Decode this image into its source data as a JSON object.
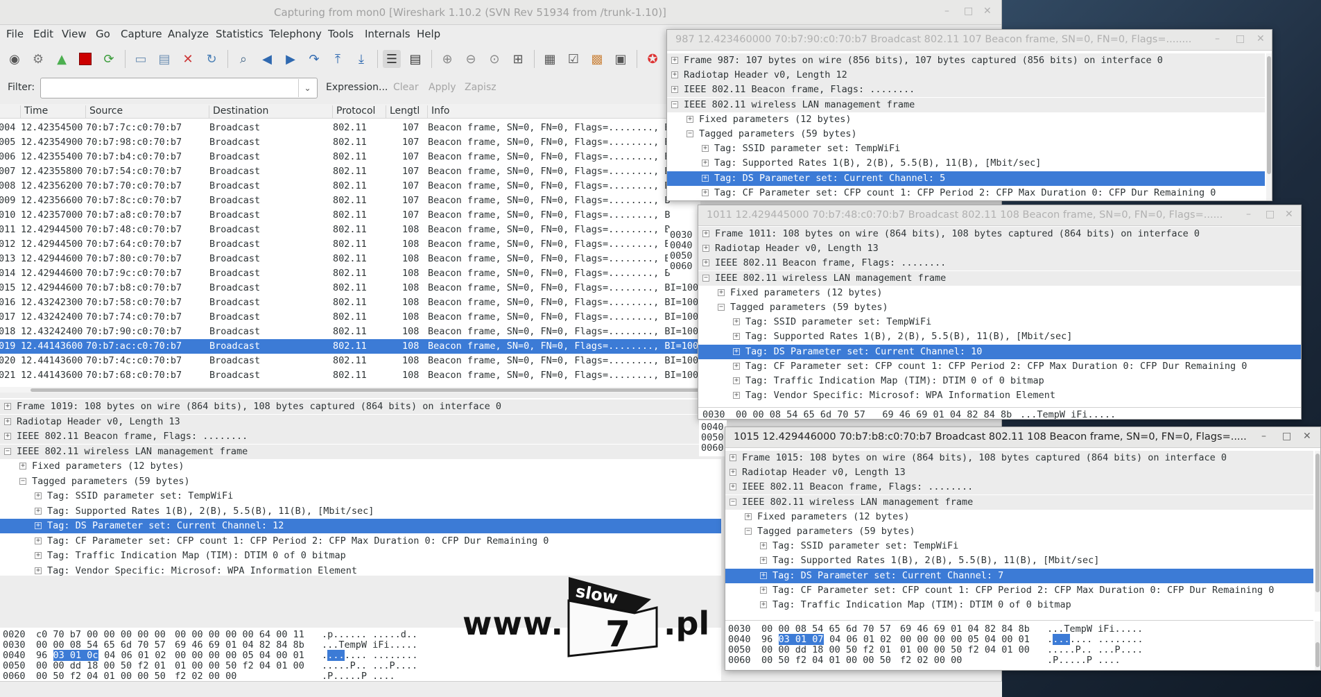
{
  "window": {
    "title": "Capturing from mon0   [Wireshark 1.10.2  (SVN Rev 51934 from /trunk-1.10)]",
    "controls": [
      "–",
      "□",
      "✕"
    ]
  },
  "menu": [
    "File",
    "Edit",
    "View",
    "Go",
    "Capture",
    "Analyze",
    "Statistics",
    "Telephony",
    "Tools",
    "Internals",
    "Help"
  ],
  "filter": {
    "label": "Filter:",
    "value": "",
    "buttons": [
      "Expression...",
      "Clear",
      "Apply",
      "Zapisz"
    ]
  },
  "packet_list": {
    "columns": [
      "Time",
      "Source",
      "Destination",
      "Protocol",
      "Lengtl",
      "Info"
    ],
    "rows": [
      {
        "no": "004",
        "time": "12.42354500",
        "src": "70:b7:7c:c0:70:b7",
        "dst": "Broadcast",
        "proto": "802.11",
        "len": "107",
        "info": "Beacon frame, SN=0, FN=0, Flags=........, B"
      },
      {
        "no": "005",
        "time": "12.42354900",
        "src": "70:b7:98:c0:70:b7",
        "dst": "Broadcast",
        "proto": "802.11",
        "len": "107",
        "info": "Beacon frame, SN=0, FN=0, Flags=........, B"
      },
      {
        "no": "006",
        "time": "12.42355400",
        "src": "70:b7:b4:c0:70:b7",
        "dst": "Broadcast",
        "proto": "802.11",
        "len": "107",
        "info": "Beacon frame, SN=0, FN=0, Flags=........, B"
      },
      {
        "no": "007",
        "time": "12.42355800",
        "src": "70:b7:54:c0:70:b7",
        "dst": "Broadcast",
        "proto": "802.11",
        "len": "107",
        "info": "Beacon frame, SN=0, FN=0, Flags=........, B"
      },
      {
        "no": "008",
        "time": "12.42356200",
        "src": "70:b7:70:c0:70:b7",
        "dst": "Broadcast",
        "proto": "802.11",
        "len": "107",
        "info": "Beacon frame, SN=0, FN=0, Flags=........, B"
      },
      {
        "no": "009",
        "time": "12.42356600",
        "src": "70:b7:8c:c0:70:b7",
        "dst": "Broadcast",
        "proto": "802.11",
        "len": "107",
        "info": "Beacon frame, SN=0, FN=0, Flags=........, B"
      },
      {
        "no": "010",
        "time": "12.42357000",
        "src": "70:b7:a8:c0:70:b7",
        "dst": "Broadcast",
        "proto": "802.11",
        "len": "107",
        "info": "Beacon frame, SN=0, FN=0, Flags=........, B"
      },
      {
        "no": "011",
        "time": "12.42944500",
        "src": "70:b7:48:c0:70:b7",
        "dst": "Broadcast",
        "proto": "802.11",
        "len": "108",
        "info": "Beacon frame, SN=0, FN=0, Flags=........, B"
      },
      {
        "no": "012",
        "time": "12.42944500",
        "src": "70:b7:64:c0:70:b7",
        "dst": "Broadcast",
        "proto": "802.11",
        "len": "108",
        "info": "Beacon frame, SN=0, FN=0, Flags=........, B"
      },
      {
        "no": "013",
        "time": "12.42944600",
        "src": "70:b7:80:c0:70:b7",
        "dst": "Broadcast",
        "proto": "802.11",
        "len": "108",
        "info": "Beacon frame, SN=0, FN=0, Flags=........, B"
      },
      {
        "no": "014",
        "time": "12.42944600",
        "src": "70:b7:9c:c0:70:b7",
        "dst": "Broadcast",
        "proto": "802.11",
        "len": "108",
        "info": "Beacon frame, SN=0, FN=0, Flags=........, B"
      },
      {
        "no": "015",
        "time": "12.42944600",
        "src": "70:b7:b8:c0:70:b7",
        "dst": "Broadcast",
        "proto": "802.11",
        "len": "108",
        "info": "Beacon frame, SN=0, FN=0, Flags=........, BI=100,"
      },
      {
        "no": "016",
        "time": "12.43242300",
        "src": "70:b7:58:c0:70:b7",
        "dst": "Broadcast",
        "proto": "802.11",
        "len": "108",
        "info": "Beacon frame, SN=0, FN=0, Flags=........, BI=100,"
      },
      {
        "no": "017",
        "time": "12.43242400",
        "src": "70:b7:74:c0:70:b7",
        "dst": "Broadcast",
        "proto": "802.11",
        "len": "108",
        "info": "Beacon frame, SN=0, FN=0, Flags=........, BI=100,"
      },
      {
        "no": "018",
        "time": "12.43242400",
        "src": "70:b7:90:c0:70:b7",
        "dst": "Broadcast",
        "proto": "802.11",
        "len": "108",
        "info": "Beacon frame, SN=0, FN=0, Flags=........, BI=100,"
      },
      {
        "no": "019",
        "time": "12.44143600",
        "src": "70:b7:ac:c0:70:b7",
        "dst": "Broadcast",
        "proto": "802.11",
        "len": "108",
        "info": "Beacon frame, SN=0, FN=0, Flags=........, BI=100,",
        "selected": true
      },
      {
        "no": "020",
        "time": "12.44143600",
        "src": "70:b7:4c:c0:70:b7",
        "dst": "Broadcast",
        "proto": "802.11",
        "len": "108",
        "info": "Beacon frame, SN=0, FN=0, Flags=........, BI=100,"
      },
      {
        "no": "021",
        "time": "12.44143600",
        "src": "70:b7:68:c0:70:b7",
        "dst": "Broadcast",
        "proto": "802.11",
        "len": "108",
        "info": "Beacon frame, SN=0, FN=0, Flags=........, BI=100,"
      }
    ]
  },
  "details": [
    {
      "exp": "+",
      "text": "Frame 1019: 108 bytes on wire (864 bits), 108 bytes captured (864 bits) on interface 0"
    },
    {
      "exp": "+",
      "text": "Radiotap Header v0, Length 13"
    },
    {
      "exp": "+",
      "text": "IEEE 802.11 Beacon frame, Flags: ........"
    },
    {
      "exp": "-",
      "text": "IEEE 802.11 wireless LAN management frame"
    },
    {
      "exp": "+",
      "text": "Fixed parameters (12 bytes)"
    },
    {
      "exp": "-",
      "text": "Tagged parameters (59 bytes)"
    },
    {
      "exp": "+",
      "text": "Tag: SSID parameter set: TempWiFi"
    },
    {
      "exp": "+",
      "text": "Tag: Supported Rates 1(B), 2(B), 5.5(B), 11(B), [Mbit/sec]"
    },
    {
      "exp": "+",
      "text": "Tag: DS Parameter set: Current Channel: 12",
      "selected": true
    },
    {
      "exp": "+",
      "text": "Tag: CF Parameter set: CFP count 1: CFP Period 2: CFP Max Duration 0: CFP Dur Remaining 0"
    },
    {
      "exp": "+",
      "text": "Tag: Traffic Indication Map (TIM): DTIM 0 of 0 bitmap"
    },
    {
      "exp": "+",
      "text": "Tag: Vendor Specific: Microsof: WPA Information Element"
    }
  ],
  "hex": [
    {
      "off": "0020",
      "hex1": "c0 70 b7 00 00 00 00 00",
      "hex2": "00 00 00 00 00 64 00 11",
      "ascii": ".p...... .....d.."
    },
    {
      "off": "0030",
      "hex1": "00 00 08 54 65 6d 70 57",
      "hex2": "69 46 69 01 04 82 84 8b",
      "ascii": "...TempW iFi....."
    },
    {
      "off": "0040",
      "pre": "96 ",
      "sel": "03 01 0c",
      "hex1": " 04 06 01 02",
      "hex2": "00 00 00 00 05 04 00 01",
      "apre": ".",
      "asel": "...",
      "ascii": ".... ........"
    },
    {
      "off": "0050",
      "hex1": "00 00 dd 18 00 50 f2 01",
      "hex2": "01 00 00 50 f2 04 01 00",
      "ascii": ".....P.. ...P...."
    },
    {
      "off": "0060",
      "hex1": "00 50 f2 04 01 00 00 50",
      "hex2": "f2 02 00 00",
      "ascii": ".P.....P ...."
    }
  ],
  "popups": [
    {
      "title": "987 12.423460000 70:b7:90:c0:70:b7 Broadcast 802.11 107 Beacon frame, SN=0, FN=0, Flags=........",
      "rows": [
        {
          "exp": "+",
          "text": "Frame 987: 107 bytes on wire (856 bits), 107 bytes captured (856 bits) on interface 0"
        },
        {
          "exp": "+",
          "text": "Radiotap Header v0, Length 12"
        },
        {
          "exp": "+",
          "text": "IEEE 802.11 Beacon frame, Flags: ........"
        },
        {
          "exp": "-",
          "text": "IEEE 802.11 wireless LAN management frame"
        },
        {
          "exp": "+",
          "text": "Fixed parameters (12 bytes)"
        },
        {
          "exp": "-",
          "text": "Tagged parameters (59 bytes)"
        },
        {
          "exp": "+",
          "text": "Tag: SSID parameter set: TempWiFi"
        },
        {
          "exp": "+",
          "text": "Tag: Supported Rates 1(B), 2(B), 5.5(B), 11(B), [Mbit/sec]"
        },
        {
          "exp": "+",
          "text": "Tag: DS Parameter set: Current Channel: 5",
          "selected": true
        },
        {
          "exp": "+",
          "text": "Tag: CF Parameter set: CFP count 1: CFP Period 2: CFP Max Duration 0: CFP Dur Remaining 0"
        }
      ],
      "hex_offsets": [
        "0030",
        "0040",
        "0050",
        "0060"
      ]
    },
    {
      "title": "1011 12.429445000 70:b7:48:c0:70:b7 Broadcast 802.11 108 Beacon frame, SN=0, FN=0, Flags=......",
      "rows": [
        {
          "exp": "+",
          "text": "Frame 1011: 108 bytes on wire (864 bits), 108 bytes captured (864 bits) on interface 0"
        },
        {
          "exp": "+",
          "text": "Radiotap Header v0, Length 13"
        },
        {
          "exp": "+",
          "text": "IEEE 802.11 Beacon frame, Flags: ........"
        },
        {
          "exp": "-",
          "text": "IEEE 802.11 wireless LAN management frame"
        },
        {
          "exp": "+",
          "text": "Fixed parameters (12 bytes)"
        },
        {
          "exp": "-",
          "text": "Tagged parameters (59 bytes)"
        },
        {
          "exp": "+",
          "text": "Tag: SSID parameter set: TempWiFi"
        },
        {
          "exp": "+",
          "text": "Tag: Supported Rates 1(B), 2(B), 5.5(B), 11(B), [Mbit/sec]"
        },
        {
          "exp": "+",
          "text": "Tag: DS Parameter set: Current Channel: 10",
          "selected": true
        },
        {
          "exp": "+",
          "text": "Tag: CF Parameter set: CFP count 1: CFP Period 2: CFP Max Duration 0: CFP Dur Remaining 0"
        },
        {
          "exp": "+",
          "text": "Tag: Traffic Indication Map (TIM): DTIM 0 of 0 bitmap"
        },
        {
          "exp": "+",
          "text": "Tag: Vendor Specific: Microsof: WPA Information Element"
        }
      ],
      "hex_first": {
        "off": "0030",
        "hex": "00 00 08 54 65 6d 70 57   69 46 69 01 04 82 84 8b",
        "ascii": "...TempW iFi....."
      },
      "hex_offsets": [
        "0040",
        "0050",
        "0060"
      ]
    },
    {
      "title": "1015 12.429446000 70:b7:b8:c0:70:b7 Broadcast 802.11 108 Beacon frame, SN=0, FN=0, Flags=.....",
      "rows": [
        {
          "exp": "+",
          "text": "Frame 1015: 108 bytes on wire (864 bits), 108 bytes captured (864 bits) on interface 0"
        },
        {
          "exp": "+",
          "text": "Radiotap Header v0, Length 13"
        },
        {
          "exp": "+",
          "text": "IEEE 802.11 Beacon frame, Flags: ........"
        },
        {
          "exp": "-",
          "text": "IEEE 802.11 wireless LAN management frame"
        },
        {
          "exp": "+",
          "text": "Fixed parameters (12 bytes)"
        },
        {
          "exp": "-",
          "text": "Tagged parameters (59 bytes)"
        },
        {
          "exp": "+",
          "text": "Tag: SSID parameter set: TempWiFi"
        },
        {
          "exp": "+",
          "text": "Tag: Supported Rates 1(B), 2(B), 5.5(B), 11(B), [Mbit/sec]"
        },
        {
          "exp": "+",
          "text": "Tag: DS Parameter set: Current Channel: 7",
          "selected": true
        },
        {
          "exp": "+",
          "text": "Tag: CF Parameter set: CFP count 1: CFP Period 2: CFP Max Duration 0: CFP Dur Remaining 0"
        },
        {
          "exp": "+",
          "text": "Tag: Traffic Indication Map (TIM): DTIM 0 of 0 bitmap"
        }
      ],
      "hex": [
        {
          "off": "0030",
          "hex1": "00 00 08 54 65 6d 70 57",
          "hex2": "69 46 69 01 04 82 84 8b",
          "ascii": "...TempW iFi....."
        },
        {
          "off": "0040",
          "pre": "96 ",
          "sel": "03 01 07",
          "hex1": " 04 06 01 02",
          "hex2": "00 00 00 00 05 04 00 01",
          "apre": ".",
          "asel": "...",
          "ascii": ".... ........"
        },
        {
          "off": "0050",
          "hex1": "00 00 dd 18 00 50 f2 01",
          "hex2": "01 00 00 50 f2 04 01 00",
          "ascii": ".....P.. ...P...."
        },
        {
          "off": "0060",
          "hex1": "00 50 f2 04 01 00 00 50",
          "hex2": "f2 02 00 00",
          "ascii": ".P.....P ...."
        }
      ]
    }
  ],
  "watermark": {
    "www": "www.",
    "slow": "slow",
    "seven": "7",
    "pl": ".pl"
  },
  "colors": {
    "selection": "#3c7bd6",
    "stop": "#cc0000",
    "fin": "#4caf50"
  }
}
